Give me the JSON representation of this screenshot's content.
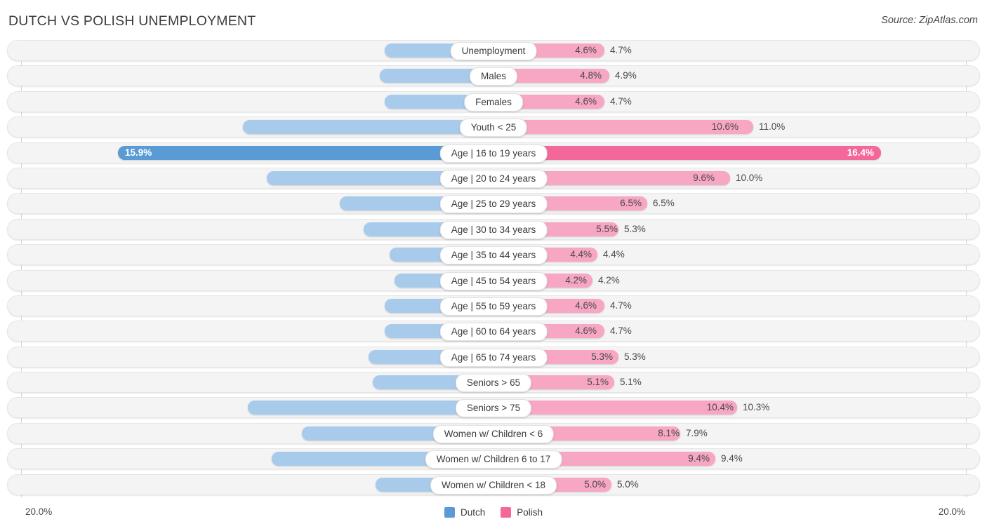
{
  "header": {
    "title": "DUTCH VS POLISH UNEMPLOYMENT",
    "source": "Source: ZipAtlas.com"
  },
  "footer": {
    "axis_left": "20.0%",
    "axis_right": "20.0%",
    "legend": [
      {
        "label": "Dutch",
        "color": "#5b9bd5"
      },
      {
        "label": "Polish",
        "color": "#f4679a"
      }
    ]
  },
  "colors": {
    "dutch_light": "#a8cbec",
    "dutch_dark": "#5b9bd5",
    "polish_light": "#f7a6c3",
    "polish_dark": "#f4679a",
    "track": "#f4f4f4",
    "gridline": "#d6d6d6"
  },
  "chart_data": {
    "type": "bar",
    "title": "DUTCH VS POLISH UNEMPLOYMENT",
    "subtitle": "Source: ZipAtlas.com",
    "orientation": "horizontal-diverging",
    "xlabel": "",
    "ylabel": "",
    "axis_max": 20.0,
    "axis_left_tick": "20.0%",
    "axis_right_tick": "20.0%",
    "grid": true,
    "legend_position": "bottom-center",
    "categories": [
      "Unemployment",
      "Males",
      "Females",
      "Youth < 25",
      "Age | 16 to 19 years",
      "Age | 20 to 24 years",
      "Age | 25 to 29 years",
      "Age | 30 to 34 years",
      "Age | 35 to 44 years",
      "Age | 45 to 54 years",
      "Age | 55 to 59 years",
      "Age | 60 to 64 years",
      "Age | 65 to 74 years",
      "Seniors > 65",
      "Seniors > 75",
      "Women w/ Children < 6",
      "Women w/ Children 6 to 17",
      "Women w/ Children < 18"
    ],
    "series": [
      {
        "name": "Dutch",
        "color": "#5b9bd5",
        "values": [
          4.6,
          4.8,
          4.6,
          10.6,
          15.9,
          9.6,
          6.5,
          5.5,
          4.4,
          4.2,
          4.6,
          4.6,
          5.3,
          5.1,
          10.4,
          8.1,
          9.4,
          5.0
        ],
        "labels": [
          "4.6%",
          "4.8%",
          "4.6%",
          "10.6%",
          "15.9%",
          "9.6%",
          "6.5%",
          "5.5%",
          "4.4%",
          "4.2%",
          "4.6%",
          "4.6%",
          "5.3%",
          "5.1%",
          "10.4%",
          "8.1%",
          "9.4%",
          "5.0%"
        ]
      },
      {
        "name": "Polish",
        "color": "#f4679a",
        "values": [
          4.7,
          4.9,
          4.7,
          11.0,
          16.4,
          10.0,
          6.5,
          5.3,
          4.4,
          4.2,
          4.7,
          4.7,
          5.3,
          5.1,
          10.3,
          7.9,
          9.4,
          5.0
        ],
        "labels": [
          "4.7%",
          "4.9%",
          "4.7%",
          "11.0%",
          "16.4%",
          "10.0%",
          "6.5%",
          "5.3%",
          "4.4%",
          "4.2%",
          "4.7%",
          "4.7%",
          "5.3%",
          "5.1%",
          "10.3%",
          "7.9%",
          "9.4%",
          "5.0%"
        ]
      }
    ],
    "highlight_row_index": 4
  }
}
